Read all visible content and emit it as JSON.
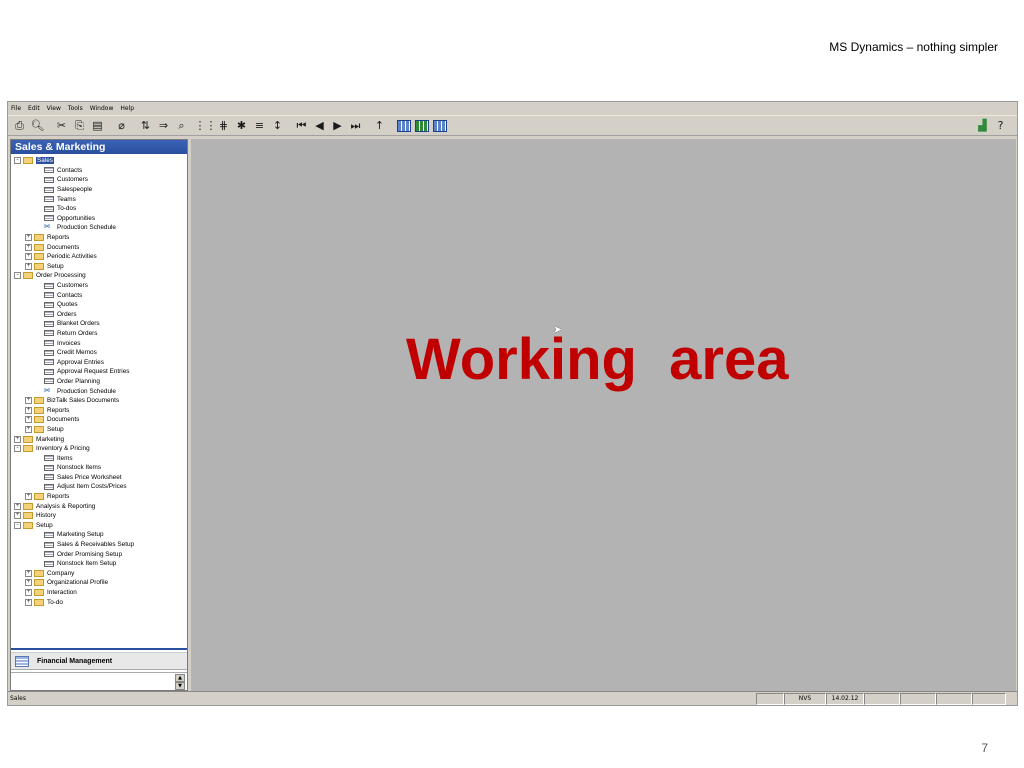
{
  "slide": {
    "header": "MS Dynamics – nothing simpler",
    "page_number": "7"
  },
  "menu": [
    "File",
    "Edit",
    "View",
    "Tools",
    "Window",
    "Help"
  ],
  "nav": {
    "title": "Sales & Marketing",
    "tree": [
      {
        "label": "Sales",
        "level": 0,
        "kind": "folder-open",
        "exp": "-",
        "selected": true
      },
      {
        "label": "Contacts",
        "level": 2,
        "kind": "form"
      },
      {
        "label": "Customers",
        "level": 2,
        "kind": "form"
      },
      {
        "label": "Salespeople",
        "level": 2,
        "kind": "form"
      },
      {
        "label": "Teams",
        "level": 2,
        "kind": "form"
      },
      {
        "label": "To-dos",
        "level": 2,
        "kind": "form"
      },
      {
        "label": "Opportunities",
        "level": 2,
        "kind": "form"
      },
      {
        "label": "Production Schedule",
        "level": 2,
        "kind": "sched"
      },
      {
        "label": "Reports",
        "level": 1,
        "kind": "folder",
        "exp": "+"
      },
      {
        "label": "Documents",
        "level": 1,
        "kind": "folder",
        "exp": "+"
      },
      {
        "label": "Periodic Activities",
        "level": 1,
        "kind": "folder",
        "exp": "+"
      },
      {
        "label": "Setup",
        "level": 1,
        "kind": "folder",
        "exp": "+"
      },
      {
        "label": "Order Processing",
        "level": 0,
        "kind": "folder-open",
        "exp": "-"
      },
      {
        "label": "Customers",
        "level": 2,
        "kind": "form"
      },
      {
        "label": "Contacts",
        "level": 2,
        "kind": "form"
      },
      {
        "label": "Quotes",
        "level": 2,
        "kind": "form"
      },
      {
        "label": "Orders",
        "level": 2,
        "kind": "form"
      },
      {
        "label": "Blanket Orders",
        "level": 2,
        "kind": "form"
      },
      {
        "label": "Return Orders",
        "level": 2,
        "kind": "form"
      },
      {
        "label": "Invoices",
        "level": 2,
        "kind": "form"
      },
      {
        "label": "Credit Memos",
        "level": 2,
        "kind": "form"
      },
      {
        "label": "Approval Entries",
        "level": 2,
        "kind": "form"
      },
      {
        "label": "Approval Request Entries",
        "level": 2,
        "kind": "form"
      },
      {
        "label": "Order Planning",
        "level": 2,
        "kind": "form"
      },
      {
        "label": "Production Schedule",
        "level": 2,
        "kind": "sched"
      },
      {
        "label": "BizTalk Sales Documents",
        "level": 1,
        "kind": "folder",
        "exp": "+"
      },
      {
        "label": "Reports",
        "level": 1,
        "kind": "folder",
        "exp": "+"
      },
      {
        "label": "Documents",
        "level": 1,
        "kind": "folder",
        "exp": "+"
      },
      {
        "label": "Setup",
        "level": 1,
        "kind": "folder",
        "exp": "+"
      },
      {
        "label": "Marketing",
        "level": 0,
        "kind": "folder",
        "exp": "+"
      },
      {
        "label": "Inventory & Pricing",
        "level": 0,
        "kind": "folder-open",
        "exp": "-"
      },
      {
        "label": "Items",
        "level": 2,
        "kind": "form"
      },
      {
        "label": "Nonstock Items",
        "level": 2,
        "kind": "form"
      },
      {
        "label": "Sales Price Worksheet",
        "level": 2,
        "kind": "form"
      },
      {
        "label": "Adjust Item Costs/Prices",
        "level": 2,
        "kind": "form"
      },
      {
        "label": "Reports",
        "level": 1,
        "kind": "folder",
        "exp": "+"
      },
      {
        "label": "Analysis & Reporting",
        "level": 0,
        "kind": "folder",
        "exp": "+"
      },
      {
        "label": "History",
        "level": 0,
        "kind": "folder",
        "exp": "+"
      },
      {
        "label": "Setup",
        "level": 0,
        "kind": "folder-open",
        "exp": "-"
      },
      {
        "label": "Marketing Setup",
        "level": 2,
        "kind": "form"
      },
      {
        "label": "Sales & Receivables Setup",
        "level": 2,
        "kind": "form"
      },
      {
        "label": "Order Promising Setup",
        "level": 2,
        "kind": "form"
      },
      {
        "label": "Nonstock Item Setup",
        "level": 2,
        "kind": "form"
      },
      {
        "label": "Company",
        "level": 1,
        "kind": "folder",
        "exp": "+"
      },
      {
        "label": "Organizational Profile",
        "level": 1,
        "kind": "folder",
        "exp": "+"
      },
      {
        "label": "Interaction",
        "level": 1,
        "kind": "folder",
        "exp": "+"
      },
      {
        "label": "To-do",
        "level": 1,
        "kind": "folder",
        "exp": "+"
      }
    ],
    "bottom_button": "Financial Management"
  },
  "work_area": {
    "label": "Working  area",
    "label_color": "#c00000"
  },
  "status": {
    "text": "Sales",
    "cells": [
      "",
      "NVS",
      "14.02.12",
      "",
      "",
      "",
      ""
    ]
  }
}
